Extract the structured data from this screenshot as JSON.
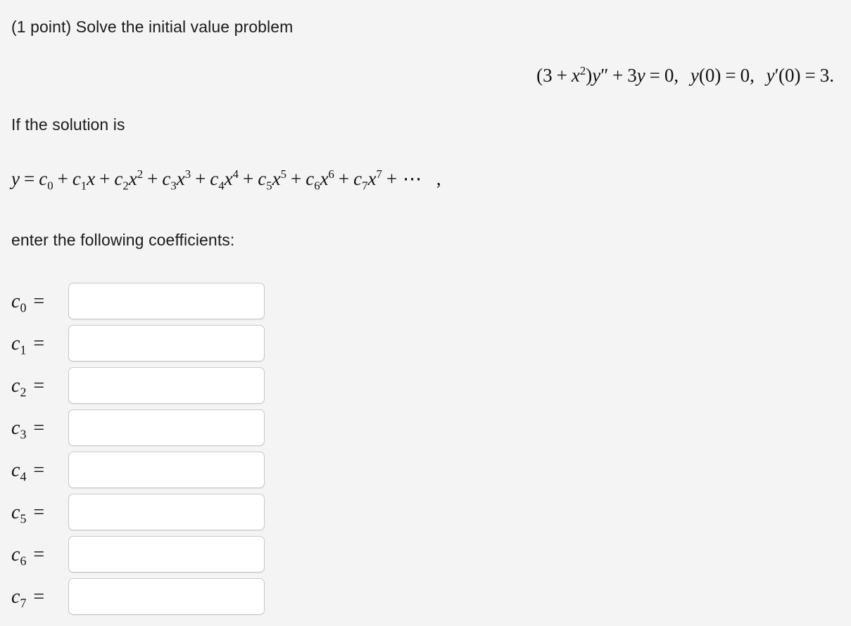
{
  "meta": {
    "background_color": "#f4f4f4",
    "text_color": "#1b1b1b",
    "input_border_color": "#c9c9c9",
    "input_background_color": "#ffffff"
  },
  "problem": {
    "points_label": "(1 point) Solve the initial value problem",
    "if_solution_label": "If the solution is",
    "enter_label": "enter the following coefficients:"
  },
  "ivp_equation": {
    "plain_text": "(3 + x²)y″ + 3y = 0, y(0) = 0, y′(0) = 3.",
    "coefficient_constant": "3",
    "x_power": "2",
    "y_term_coefficient": "3",
    "rhs": "0",
    "initial_condition_y": "0",
    "initial_condition_yprime": "3",
    "open_paren": "(",
    "close_paren": ")",
    "plus": "+",
    "equals": "=",
    "comma": ",",
    "period": ".",
    "y_symbol": "y",
    "x_symbol": "x",
    "double_prime": "″",
    "single_prime": "′"
  },
  "series_equation": {
    "plain_text": "y = c0 + c1x + c2x² + c3x³ + c4x⁴ + c5x⁵ + c6x⁶ + c7x⁷ + ⋯ ,",
    "lhs": "y",
    "equals": "=",
    "plus": "+",
    "c_symbol": "c",
    "x_symbol": "x",
    "ellipsis": "⋯",
    "trailing_comma": ",",
    "terms": [
      {
        "coefficient_index": "0",
        "x_power": ""
      },
      {
        "coefficient_index": "1",
        "x_power": ""
      },
      {
        "coefficient_index": "2",
        "x_power": "2"
      },
      {
        "coefficient_index": "3",
        "x_power": "3"
      },
      {
        "coefficient_index": "4",
        "x_power": "4"
      },
      {
        "coefficient_index": "5",
        "x_power": "5"
      },
      {
        "coefficient_index": "6",
        "x_power": "6"
      },
      {
        "coefficient_index": "7",
        "x_power": "7"
      }
    ]
  },
  "coefficients": [
    {
      "symbol": "c",
      "index": "0",
      "equals": "=",
      "value": "",
      "placeholder": ""
    },
    {
      "symbol": "c",
      "index": "1",
      "equals": "=",
      "value": "",
      "placeholder": ""
    },
    {
      "symbol": "c",
      "index": "2",
      "equals": "=",
      "value": "",
      "placeholder": ""
    },
    {
      "symbol": "c",
      "index": "3",
      "equals": "=",
      "value": "",
      "placeholder": ""
    },
    {
      "symbol": "c",
      "index": "4",
      "equals": "=",
      "value": "",
      "placeholder": ""
    },
    {
      "symbol": "c",
      "index": "5",
      "equals": "=",
      "value": "",
      "placeholder": ""
    },
    {
      "symbol": "c",
      "index": "6",
      "equals": "=",
      "value": "",
      "placeholder": ""
    },
    {
      "symbol": "c",
      "index": "7",
      "equals": "=",
      "value": "",
      "placeholder": ""
    }
  ]
}
